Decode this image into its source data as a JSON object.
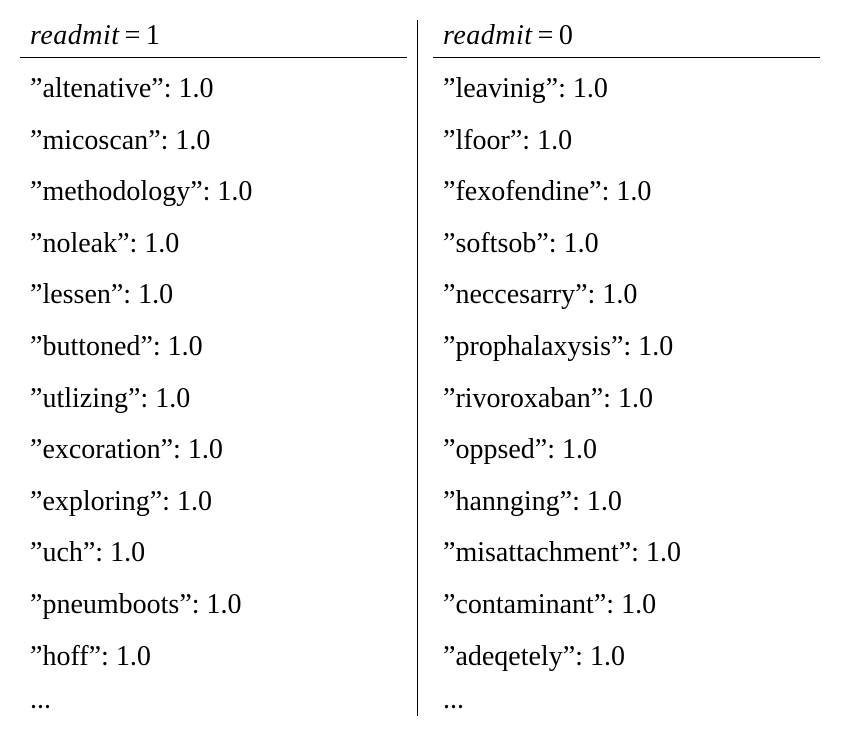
{
  "chart_data": {
    "type": "table",
    "title": "",
    "columns": [
      {
        "header": "readmit = 1",
        "header_var": "readmit",
        "header_val": "1",
        "rows": [
          {
            "term": "altenative",
            "value": "1.0"
          },
          {
            "term": "micoscan",
            "value": "1.0"
          },
          {
            "term": "methodology",
            "value": "1.0"
          },
          {
            "term": "noleak",
            "value": "1.0"
          },
          {
            "term": "lessen",
            "value": "1.0"
          },
          {
            "term": "buttoned",
            "value": "1.0"
          },
          {
            "term": "utlizing",
            "value": "1.0"
          },
          {
            "term": "excoration",
            "value": "1.0"
          },
          {
            "term": "exploring",
            "value": "1.0"
          },
          {
            "term": "uch",
            "value": "1.0"
          },
          {
            "term": "pneumboots",
            "value": "1.0"
          },
          {
            "term": "hoff",
            "value": "1.0"
          }
        ],
        "ellipsis": "..."
      },
      {
        "header": "readmit = 0",
        "header_var": "readmit",
        "header_val": "0",
        "rows": [
          {
            "term": "leavinig",
            "value": "1.0"
          },
          {
            "term": "lfoor",
            "value": "1.0"
          },
          {
            "term": "fexofendine",
            "value": "1.0"
          },
          {
            "term": "softsob",
            "value": "1.0"
          },
          {
            "term": "neccesarry",
            "value": "1.0"
          },
          {
            "term": "prophalaxysis",
            "value": "1.0"
          },
          {
            "term": "rivoroxaban",
            "value": "1.0"
          },
          {
            "term": "oppsed",
            "value": "1.0"
          },
          {
            "term": "hannging",
            "value": "1.0"
          },
          {
            "term": "misattachment",
            "value": "1.0"
          },
          {
            "term": "contaminant",
            "value": "1.0"
          },
          {
            "term": "adeqetely",
            "value": "1.0"
          }
        ],
        "ellipsis": "..."
      }
    ]
  }
}
